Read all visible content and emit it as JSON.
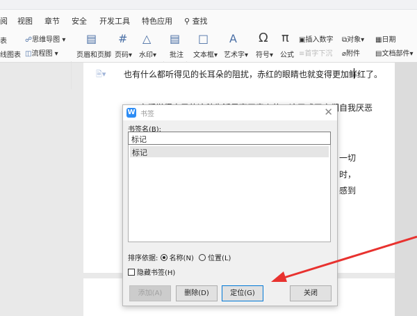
{
  "tabs": [
    "阅",
    "视图",
    "章节",
    "安全",
    "开发工具",
    "特色应用",
    "查找"
  ],
  "ribbon": {
    "tb1": "表",
    "tb2": "线图表",
    "mind": "思维导图",
    "flow": "流程图",
    "header_footer": "页眉和页脚",
    "page_num": "页码",
    "watermark": "水印",
    "comment": "批注",
    "textbox": "文本框",
    "wordart": "艺术字",
    "symbol": "符号",
    "formula": "公式",
    "insert_number": "插入数字",
    "dropcap": "首字下沉",
    "object": "对象",
    "attachment": "附件",
    "date": "日期",
    "doc_parts": "文档部件"
  },
  "doc": {
    "line1": "也有什么都听得见的长耳朵的阻扰，赤红的眼睛也就变得更加鲜红了。",
    "line2": "它们觉得自己的这种生活是毫无意义的，这又成了它们自我厌恶",
    "frag1": "一切",
    "frag2": "时，",
    "frag3": "感到"
  },
  "dialog": {
    "title": "书签",
    "name_label": "书签名(B):",
    "name_value": "标记",
    "items": [
      "标记"
    ],
    "sort_label": "排序依据:",
    "sort_name": "名称(N)",
    "sort_pos": "位置(L)",
    "hide_label": "隐藏书签(H)",
    "add": "添加(A)",
    "delete": "删除(D)",
    "goto": "定位(G)",
    "close": "关闭"
  },
  "colors": {
    "arrow": "#e8322f",
    "accent": "#0078d7"
  }
}
